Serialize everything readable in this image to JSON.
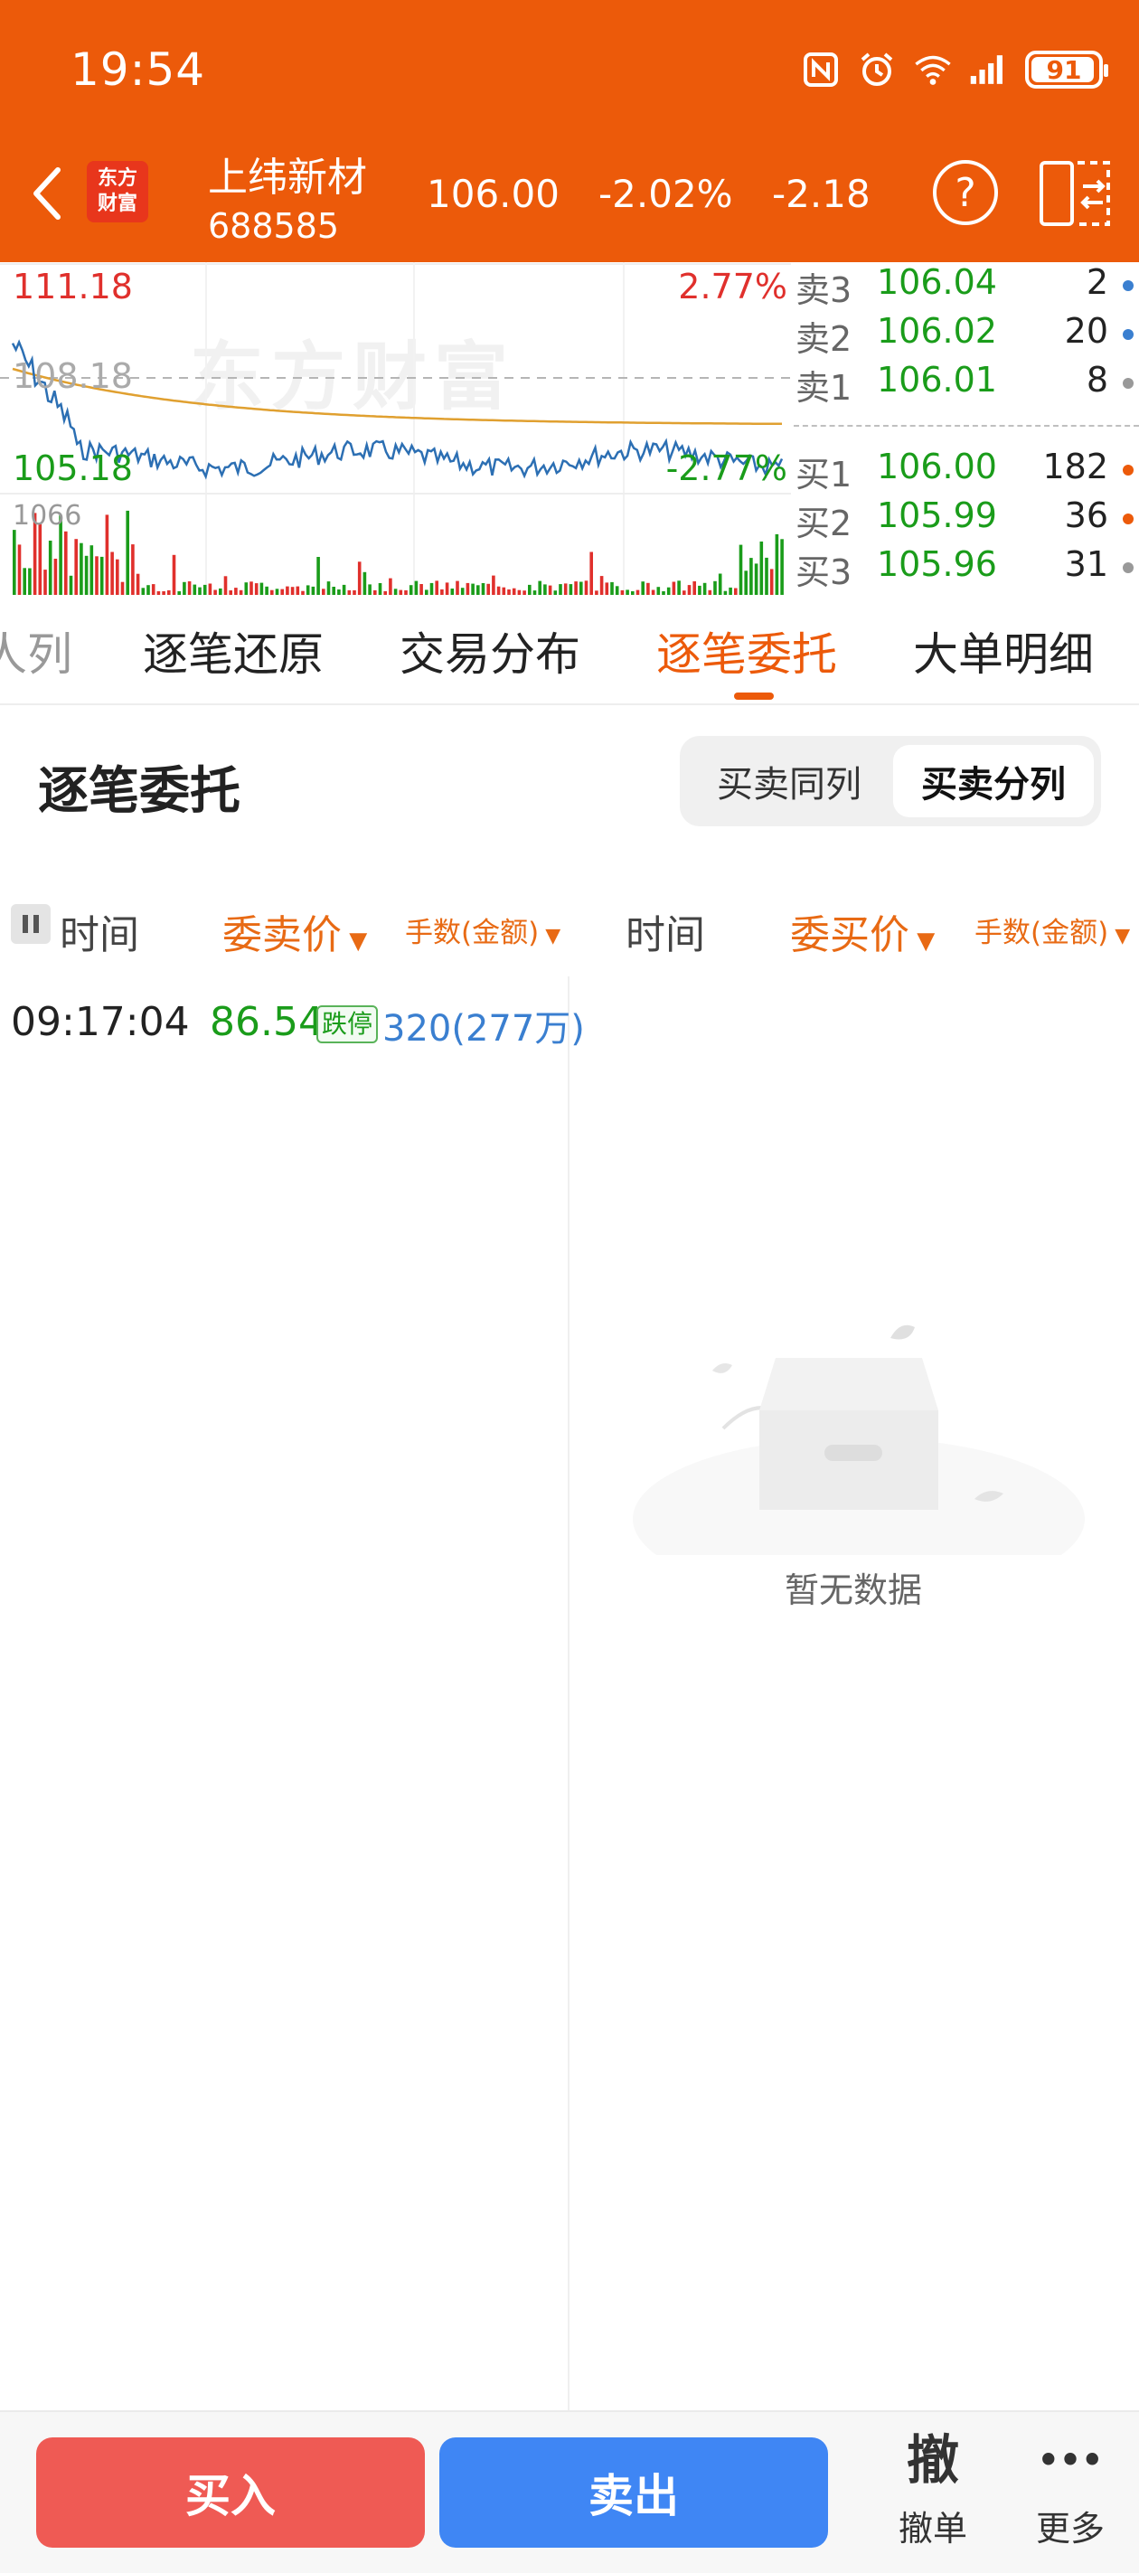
{
  "status_bar": {
    "time": "19:54",
    "battery": "91"
  },
  "header": {
    "logo_line1": "东方",
    "logo_line2": "财富",
    "stock_name": "上纬新材",
    "stock_code": "688585",
    "price": "106.00",
    "change_pct": "-2.02%",
    "change": "-2.18"
  },
  "chart": {
    "high_price": "111.18",
    "high_pct": "2.77%",
    "mid_price": "108.18",
    "low_price": "105.18",
    "low_pct": "-2.77%",
    "volume_label": "1066",
    "watermark": "东方财富",
    "colors": {
      "price_line": "#2c6fb3",
      "avg_line": "#e0a030",
      "up": "#e0302c",
      "down": "#1a9c1a"
    }
  },
  "order_book": {
    "asks": [
      {
        "side": "卖3",
        "price": "106.04",
        "vol": "2",
        "dot": "#3a7fd0"
      },
      {
        "side": "卖2",
        "price": "106.02",
        "vol": "20",
        "dot": "#3a7fd0"
      },
      {
        "side": "卖1",
        "price": "106.01",
        "vol": "8",
        "dot": "#999999"
      }
    ],
    "bids": [
      {
        "side": "买1",
        "price": "106.00",
        "vol": "182",
        "dot": "#ec5a0a"
      },
      {
        "side": "买2",
        "price": "105.99",
        "vol": "36",
        "dot": "#ec5a0a"
      },
      {
        "side": "买3",
        "price": "105.96",
        "vol": "31",
        "dot": "#999999"
      }
    ]
  },
  "tabs": [
    "人列",
    "逐笔还原",
    "交易分布",
    "逐笔委托",
    "大单明细"
  ],
  "active_tab": "逐笔委托",
  "section": {
    "title": "逐笔委托",
    "toggle": [
      "买卖同列",
      "买卖分列"
    ],
    "toggle_active": "买卖分列"
  },
  "table": {
    "headers": {
      "time_left": "时间",
      "ask_price": "委卖价",
      "lots_left": "手数(金额)",
      "time_right": "时间",
      "bid_price": "委买价",
      "lots_right": "手数(金额)"
    },
    "sell_rows": [
      {
        "time": "09:17:04",
        "price": "86.54",
        "badge": "跌停",
        "volume": "320(277万)"
      }
    ],
    "buy_empty_text": "暂无数据"
  },
  "bottom_bar": {
    "buy": "买入",
    "sell": "卖出",
    "cancel_glyph": "撤",
    "cancel_label": "撤单",
    "more_glyph": "•••",
    "more_label": "更多"
  }
}
